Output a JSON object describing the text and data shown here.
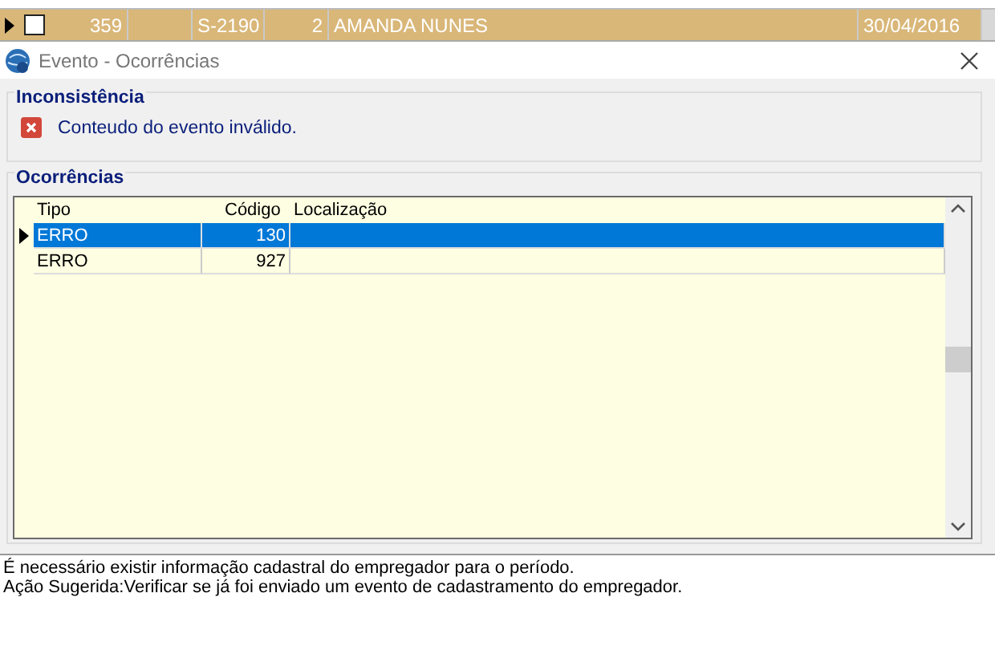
{
  "background_grid": {
    "row": {
      "current": true,
      "checked": false,
      "cells": [
        "359",
        "S-2190",
        "2",
        "AMANDA NUNES",
        "30/04/2016"
      ]
    }
  },
  "window": {
    "title": "Evento - Ocorrências"
  },
  "inconsistencia": {
    "title": "Inconsistência",
    "message": "Conteudo do evento inválido."
  },
  "ocorrencias": {
    "title": "Ocorrências",
    "columns": [
      "Tipo",
      "Código",
      "Localização"
    ],
    "rows": [
      {
        "selected": true,
        "cells": [
          "ERRO",
          "130",
          ""
        ]
      },
      {
        "selected": false,
        "cells": [
          "ERRO",
          "927",
          ""
        ]
      }
    ]
  },
  "details": [
    "É necessário existir informação cadastral do empregador para o período.",
    "Ação Sugerida:Verificar se já foi enviado um evento de cadastramento do empregador."
  ]
}
